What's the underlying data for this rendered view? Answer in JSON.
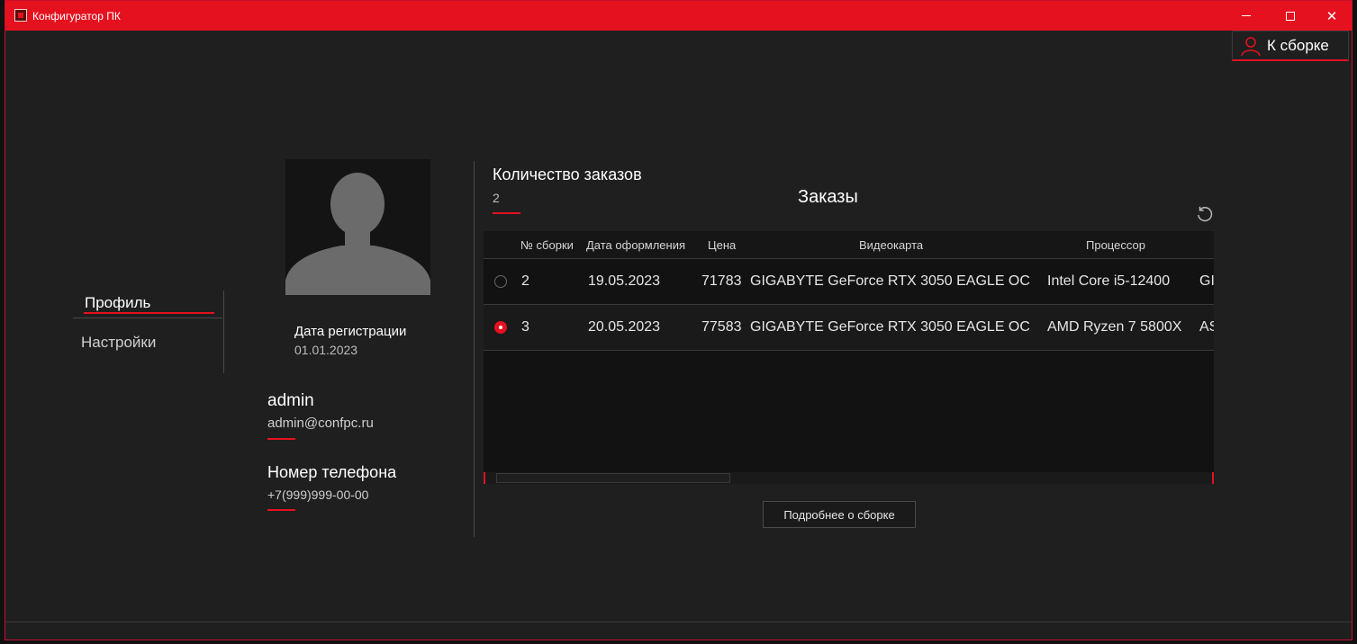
{
  "window": {
    "title": "Конфигуратор ПК",
    "accent": "#e5111f"
  },
  "header": {
    "to_build_label": "К сборке"
  },
  "sidebar": {
    "items": [
      {
        "label": "Профиль",
        "active": true
      },
      {
        "label": "Настройки",
        "active": false
      }
    ]
  },
  "profile": {
    "reg_label": "Дата регистрации",
    "reg_date": "01.01.2023",
    "username": "admin",
    "email": "admin@confpc.ru",
    "phone_label": "Номер телефона",
    "phone": "+7(999)999-00-00"
  },
  "orders": {
    "count_label": "Количество заказов",
    "count": "2",
    "title": "Заказы",
    "columns": [
      "№ сборки",
      "Дата оформления",
      "Цена",
      "Видеокарта",
      "Процессор"
    ],
    "rows": [
      {
        "selected": false,
        "id": "2",
        "date": "19.05.2023",
        "price": "71783",
        "gpu": "GIGABYTE GeForce RTX 3050 EAGLE OC",
        "cpu": "Intel Core i5-12400",
        "extra": "GI"
      },
      {
        "selected": true,
        "id": "3",
        "date": "20.05.2023",
        "price": "77583",
        "gpu": "GIGABYTE GeForce RTX 3050 EAGLE OC",
        "cpu": "AMD Ryzen 7 5800X",
        "extra": "AS"
      }
    ],
    "details_button": "Подробнее о сборке"
  }
}
